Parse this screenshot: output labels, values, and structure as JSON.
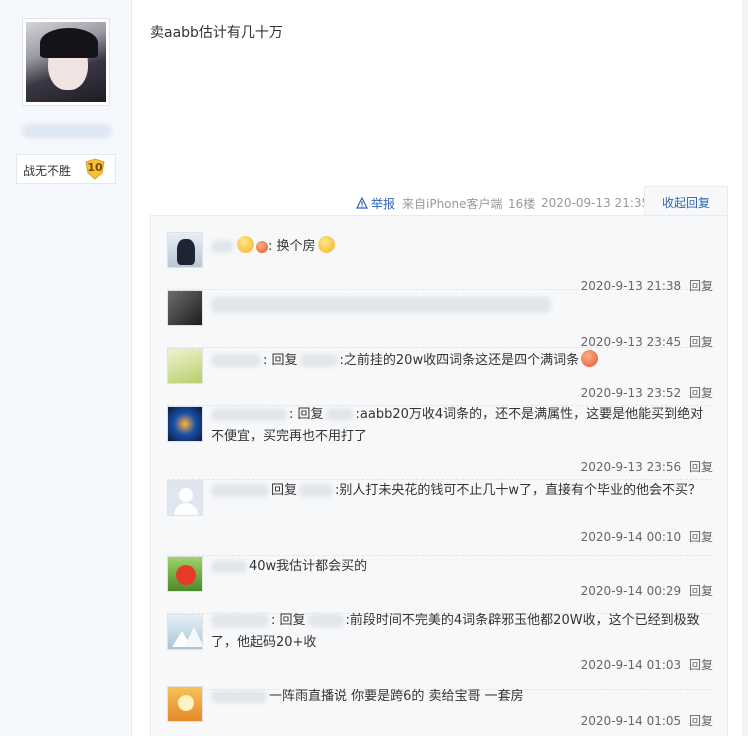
{
  "author": {
    "rank_title": "战无不胜",
    "level": "10"
  },
  "post": {
    "content": "卖aabb估计有几十万",
    "report_label": "举报",
    "source": "来自iPhone客户端",
    "floor": "16楼",
    "time": "2020-09-13 21:35",
    "collapse_label": "收起回复"
  },
  "replies": [
    {
      "text": ": 换个房",
      "time": "2020-9-13 21:38",
      "reply_label": "回复"
    },
    {
      "text": "",
      "time": "2020-9-13 23:45",
      "reply_label": "回复"
    },
    {
      "prefix": ": 回复",
      "text": ":之前挂的20w收四词条这还是四个满词条",
      "time": "2020-9-13 23:52",
      "reply_label": "回复"
    },
    {
      "prefix": ": 回复",
      "text": ":aabb20万收4词条的，还不是满属性，这要是他能买到绝对不便宜，买完再也不用打了",
      "time": "2020-9-13 23:56",
      "reply_label": "回复"
    },
    {
      "prefix": "回复",
      "text": ":别人打未央花的钱可不止几十w了，直接有个毕业的他会不买？",
      "time": "2020-9-14 00:10",
      "reply_label": "回复"
    },
    {
      "text": "40w我估计都会买的",
      "time": "2020-9-14 00:29",
      "reply_label": "回复"
    },
    {
      "prefix": ": 回复",
      "text": ":前段时间不完美的4词条辟邪玉他都20W收，这个已经到极致了，他起码20+收",
      "time": "2020-9-14 01:03",
      "reply_label": "回复"
    },
    {
      "text": "一阵雨直播说 你要是跨6的 卖给宝哥 一套房",
      "time": "2020-9-14 01:05",
      "reply_label": "回复"
    }
  ]
}
